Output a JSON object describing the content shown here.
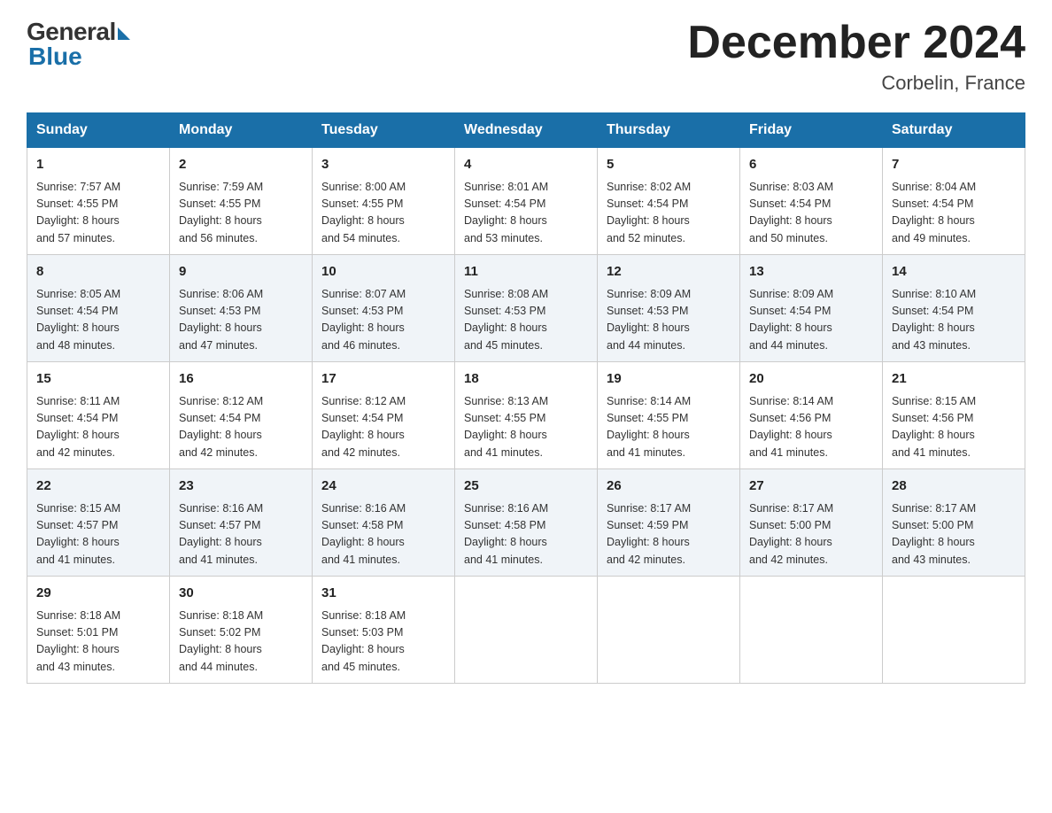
{
  "logo": {
    "general": "General",
    "blue": "Blue"
  },
  "title": "December 2024",
  "location": "Corbelin, France",
  "days_of_week": [
    "Sunday",
    "Monday",
    "Tuesday",
    "Wednesday",
    "Thursday",
    "Friday",
    "Saturday"
  ],
  "weeks": [
    [
      {
        "day": "1",
        "sunrise": "7:57 AM",
        "sunset": "4:55 PM",
        "daylight": "8 hours and 57 minutes."
      },
      {
        "day": "2",
        "sunrise": "7:59 AM",
        "sunset": "4:55 PM",
        "daylight": "8 hours and 56 minutes."
      },
      {
        "day": "3",
        "sunrise": "8:00 AM",
        "sunset": "4:55 PM",
        "daylight": "8 hours and 54 minutes."
      },
      {
        "day": "4",
        "sunrise": "8:01 AM",
        "sunset": "4:54 PM",
        "daylight": "8 hours and 53 minutes."
      },
      {
        "day": "5",
        "sunrise": "8:02 AM",
        "sunset": "4:54 PM",
        "daylight": "8 hours and 52 minutes."
      },
      {
        "day": "6",
        "sunrise": "8:03 AM",
        "sunset": "4:54 PM",
        "daylight": "8 hours and 50 minutes."
      },
      {
        "day": "7",
        "sunrise": "8:04 AM",
        "sunset": "4:54 PM",
        "daylight": "8 hours and 49 minutes."
      }
    ],
    [
      {
        "day": "8",
        "sunrise": "8:05 AM",
        "sunset": "4:54 PM",
        "daylight": "8 hours and 48 minutes."
      },
      {
        "day": "9",
        "sunrise": "8:06 AM",
        "sunset": "4:53 PM",
        "daylight": "8 hours and 47 minutes."
      },
      {
        "day": "10",
        "sunrise": "8:07 AM",
        "sunset": "4:53 PM",
        "daylight": "8 hours and 46 minutes."
      },
      {
        "day": "11",
        "sunrise": "8:08 AM",
        "sunset": "4:53 PM",
        "daylight": "8 hours and 45 minutes."
      },
      {
        "day": "12",
        "sunrise": "8:09 AM",
        "sunset": "4:53 PM",
        "daylight": "8 hours and 44 minutes."
      },
      {
        "day": "13",
        "sunrise": "8:09 AM",
        "sunset": "4:54 PM",
        "daylight": "8 hours and 44 minutes."
      },
      {
        "day": "14",
        "sunrise": "8:10 AM",
        "sunset": "4:54 PM",
        "daylight": "8 hours and 43 minutes."
      }
    ],
    [
      {
        "day": "15",
        "sunrise": "8:11 AM",
        "sunset": "4:54 PM",
        "daylight": "8 hours and 42 minutes."
      },
      {
        "day": "16",
        "sunrise": "8:12 AM",
        "sunset": "4:54 PM",
        "daylight": "8 hours and 42 minutes."
      },
      {
        "day": "17",
        "sunrise": "8:12 AM",
        "sunset": "4:54 PM",
        "daylight": "8 hours and 42 minutes."
      },
      {
        "day": "18",
        "sunrise": "8:13 AM",
        "sunset": "4:55 PM",
        "daylight": "8 hours and 41 minutes."
      },
      {
        "day": "19",
        "sunrise": "8:14 AM",
        "sunset": "4:55 PM",
        "daylight": "8 hours and 41 minutes."
      },
      {
        "day": "20",
        "sunrise": "8:14 AM",
        "sunset": "4:56 PM",
        "daylight": "8 hours and 41 minutes."
      },
      {
        "day": "21",
        "sunrise": "8:15 AM",
        "sunset": "4:56 PM",
        "daylight": "8 hours and 41 minutes."
      }
    ],
    [
      {
        "day": "22",
        "sunrise": "8:15 AM",
        "sunset": "4:57 PM",
        "daylight": "8 hours and 41 minutes."
      },
      {
        "day": "23",
        "sunrise": "8:16 AM",
        "sunset": "4:57 PM",
        "daylight": "8 hours and 41 minutes."
      },
      {
        "day": "24",
        "sunrise": "8:16 AM",
        "sunset": "4:58 PM",
        "daylight": "8 hours and 41 minutes."
      },
      {
        "day": "25",
        "sunrise": "8:16 AM",
        "sunset": "4:58 PM",
        "daylight": "8 hours and 41 minutes."
      },
      {
        "day": "26",
        "sunrise": "8:17 AM",
        "sunset": "4:59 PM",
        "daylight": "8 hours and 42 minutes."
      },
      {
        "day": "27",
        "sunrise": "8:17 AM",
        "sunset": "5:00 PM",
        "daylight": "8 hours and 42 minutes."
      },
      {
        "day": "28",
        "sunrise": "8:17 AM",
        "sunset": "5:00 PM",
        "daylight": "8 hours and 43 minutes."
      }
    ],
    [
      {
        "day": "29",
        "sunrise": "8:18 AM",
        "sunset": "5:01 PM",
        "daylight": "8 hours and 43 minutes."
      },
      {
        "day": "30",
        "sunrise": "8:18 AM",
        "sunset": "5:02 PM",
        "daylight": "8 hours and 44 minutes."
      },
      {
        "day": "31",
        "sunrise": "8:18 AM",
        "sunset": "5:03 PM",
        "daylight": "8 hours and 45 minutes."
      },
      null,
      null,
      null,
      null
    ]
  ],
  "labels": {
    "sunrise": "Sunrise:",
    "sunset": "Sunset:",
    "daylight": "Daylight:"
  }
}
